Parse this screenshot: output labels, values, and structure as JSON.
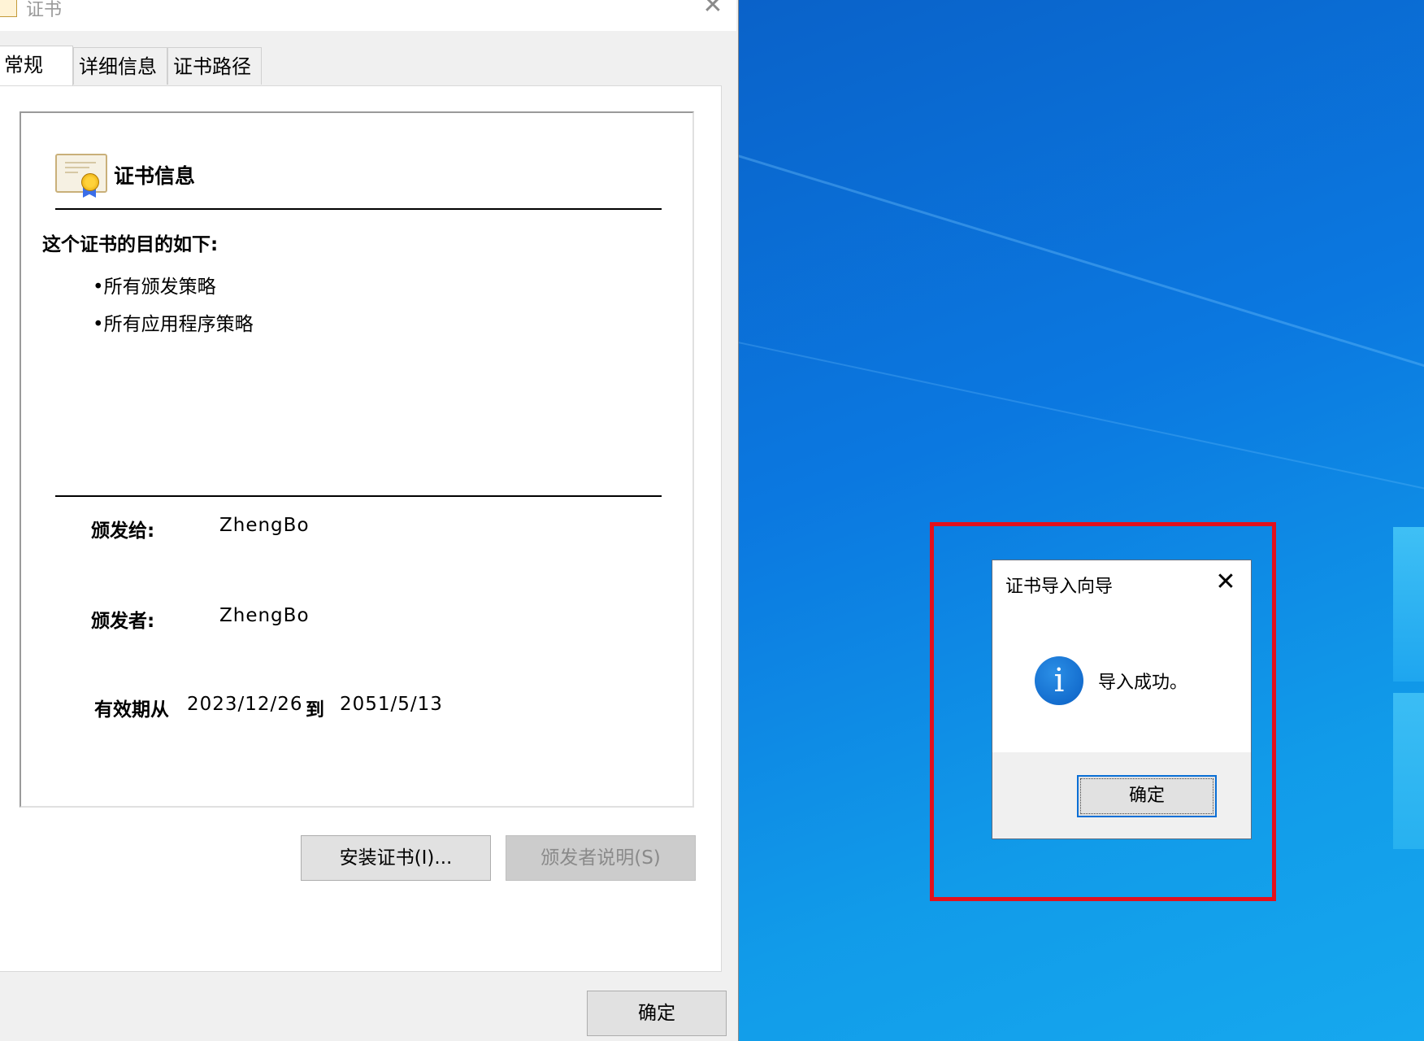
{
  "cert_window": {
    "title": "证书",
    "tabs": [
      {
        "label": "常规"
      },
      {
        "label": "详细信息"
      },
      {
        "label": "证书路径"
      }
    ],
    "heading": "证书信息",
    "purpose_title": "这个证书的目的如下:",
    "purposes": [
      "•所有颁发策略",
      "•所有应用程序策略"
    ],
    "issued_to_label": "颁发给:",
    "issued_to_value": "ZhengBo",
    "issued_by_label": "颁发者:",
    "issued_by_value": "ZhengBo",
    "valid_from_label": "有效期从",
    "valid_from_value": "2023/12/26",
    "valid_to_label": "到",
    "valid_to_value": "2051/5/13",
    "install_button": "安装证书(I)...",
    "issuer_statement_button": "颁发者说明(S)",
    "ok_button": "确定"
  },
  "message_box": {
    "title": "证书导入向导",
    "text": "导入成功。",
    "ok_button": "确定",
    "icon": "information-icon"
  },
  "colors": {
    "highlight": "#e3101c",
    "desktop": "#0b78e0"
  }
}
